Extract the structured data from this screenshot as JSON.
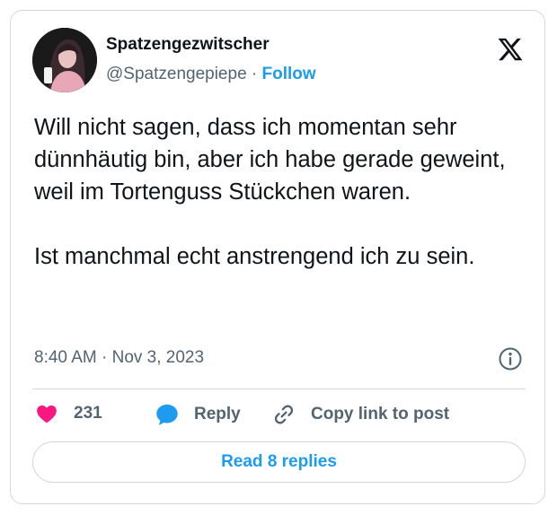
{
  "author": {
    "display_name": "Spatzengezwitscher",
    "handle": "@Spatzengepiepe",
    "separator": "·",
    "follow_label": "Follow"
  },
  "tweet": {
    "paragraphs": [
      "Will nicht sagen, dass ich momentan sehr dünnhäutig bin, aber ich habe gerade geweint, weil im Tortenguss Stückchen waren.",
      "Ist manchmal echt anstrengend ich zu sein."
    ],
    "timestamp": "8:40 AM · Nov 3, 2023"
  },
  "actions": {
    "like_count": "231",
    "reply_label": "Reply",
    "copy_link_label": "Copy link to post"
  },
  "read_replies_label": "Read 8 replies",
  "icons": {
    "brand": "x-logo-icon",
    "info": "info-icon",
    "like": "heart-icon",
    "reply": "speech-bubble-icon",
    "copy": "link-icon"
  },
  "colors": {
    "accent": "#1d9bf0",
    "like": "#f91880",
    "secondary_text": "#536471",
    "border": "#cfd9de"
  }
}
